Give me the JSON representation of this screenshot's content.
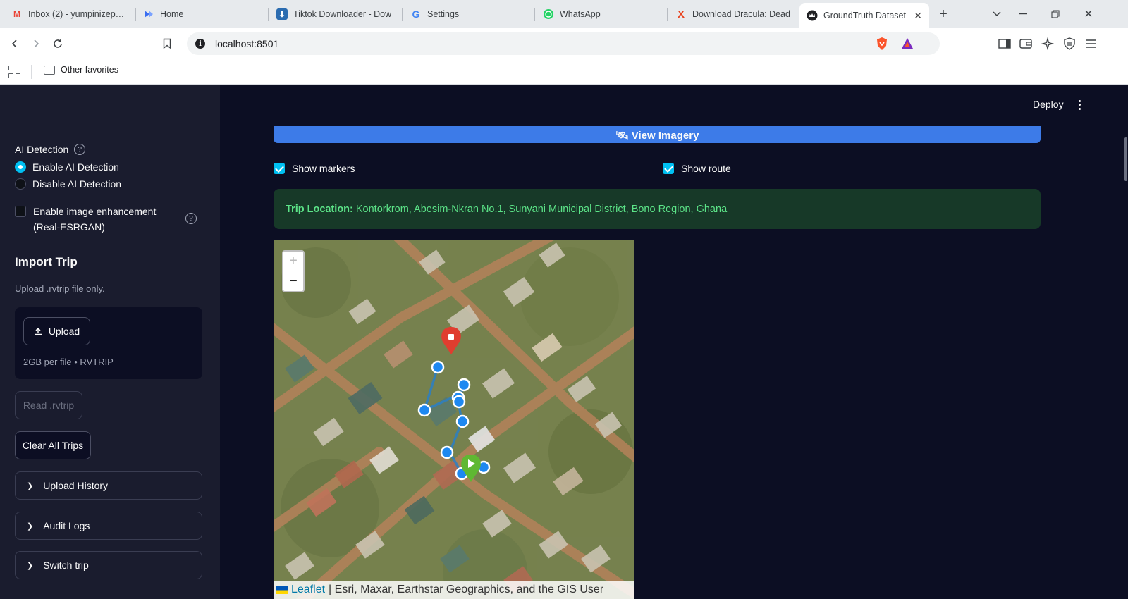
{
  "browser": {
    "tabs": [
      {
        "title": "Inbox (2) - yumpinizephar",
        "icon": "gmail-icon",
        "color": "#ea4335"
      },
      {
        "title": "Home",
        "icon": "clipchamp-icon",
        "color": "#3b6ef0"
      },
      {
        "title": "Tiktok Downloader - Dow",
        "icon": "download-icon",
        "color": "#2b6cb0"
      },
      {
        "title": "Settings",
        "icon": "google-icon",
        "color": "#4285f4"
      },
      {
        "title": "WhatsApp",
        "icon": "whatsapp-icon",
        "color": "#25d366"
      },
      {
        "title": "Download Dracula: Dead",
        "icon": "x-icon",
        "color": "#e8431f"
      },
      {
        "title": "GroundTruth Dataset",
        "icon": "crown-icon",
        "color": "#202124"
      }
    ],
    "url": "localhost:8501",
    "bookmark_folder": "Other favorites"
  },
  "sidebar": {
    "ai_label": "AI Detection",
    "radio_options": [
      "Enable AI Detection",
      "Disable AI Detection"
    ],
    "enhancement_label": "Enable image enhancement (Real-ESRGAN)",
    "import_title": "Import Trip",
    "import_caption": "Upload .rvtrip file only.",
    "upload_label": "Upload",
    "upload_caption": "2GB per file • RVTRIP",
    "read_label": "Read .rvtrip",
    "clear_label": "Clear All Trips",
    "expanders": [
      "Upload History",
      "Audit Logs",
      "Switch trip"
    ]
  },
  "main": {
    "deploy": "Deploy",
    "view_imagery": "View Imagery",
    "show_markers": "Show markers",
    "show_route": "Show route",
    "trip_location_label": "Trip Location:",
    "trip_location_value": "Kontorkrom, Abesim-Nkran No.1, Sunyani Municipal District, Bono Region, Ghana",
    "map": {
      "zoom_in": "+",
      "zoom_out": "−",
      "attribution_link": "Leaflet",
      "attribution_text": "| Esri, Maxar, Earthstar Geographics, and the GIS User"
    }
  }
}
